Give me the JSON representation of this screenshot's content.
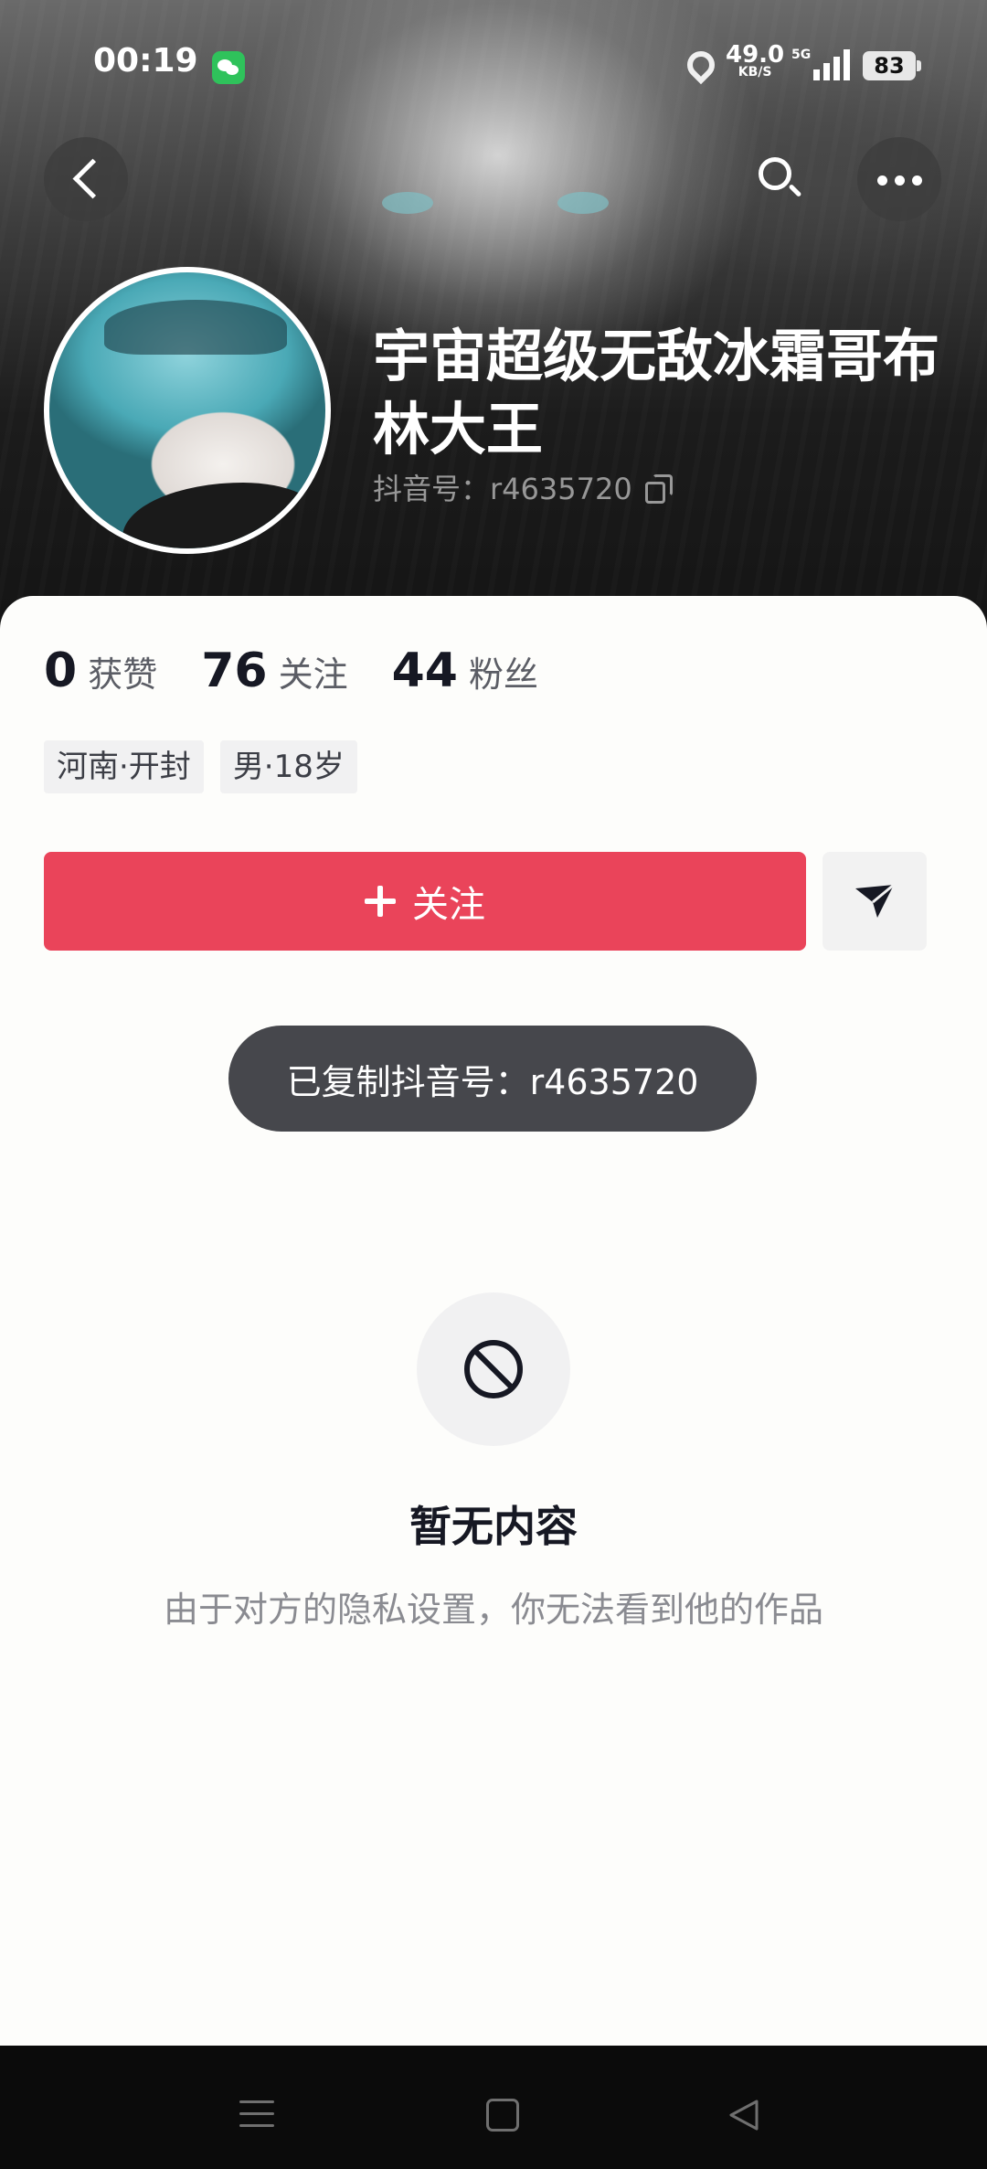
{
  "status_bar": {
    "time": "00:19",
    "net_speed_value": "49.0",
    "net_speed_unit": "KB/S",
    "network_type": "5G",
    "battery": "83"
  },
  "profile": {
    "display_name": "宇宙超级无敌冰霜哥布林大王",
    "douyin_id": "抖音号：r4635720"
  },
  "stats": [
    {
      "value": "0",
      "label": "获赞"
    },
    {
      "value": "76",
      "label": "关注"
    },
    {
      "value": "44",
      "label": "粉丝"
    }
  ],
  "tags": [
    {
      "label": "河南·开封"
    },
    {
      "label": "男·18岁"
    }
  ],
  "actions": {
    "follow_label": "关注"
  },
  "toast": {
    "text": "已复制抖音号：r4635720"
  },
  "empty_state": {
    "title": "暂无内容",
    "description": "由于对方的隐私设置，你无法看到他的作品"
  },
  "colors": {
    "accent": "#ea445a",
    "toast_bg": "#46474c",
    "text_primary": "#161823",
    "text_secondary": "#8a8b91"
  },
  "icons": [
    "wechat-icon",
    "location-icon",
    "signal-icon",
    "battery-icon",
    "back-icon",
    "search-icon",
    "more-icon",
    "copy-icon",
    "plus-icon",
    "send-icon",
    "forbidden-icon",
    "nav-menu-icon",
    "nav-home-icon",
    "nav-back-icon"
  ]
}
